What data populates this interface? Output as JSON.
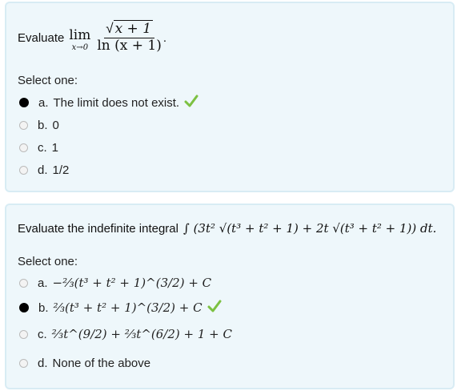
{
  "q1": {
    "prefix": "Evaluate",
    "lim": "lim",
    "lim_sub": "x→0",
    "numerator": "x + 1",
    "denominator": "ln (x + 1)",
    "suffix": ".",
    "select_label": "Select one:",
    "options": [
      {
        "letter": "a.",
        "text": "The limit does not exist.",
        "selected": true,
        "correct_mark": true
      },
      {
        "letter": "b.",
        "text": "0",
        "selected": false
      },
      {
        "letter": "c.",
        "text": "1",
        "selected": false
      },
      {
        "letter": "d.",
        "text": "1/2",
        "selected": false
      }
    ]
  },
  "q2": {
    "prefix": "Evaluate the indefinite integral",
    "integral": "∫ (3t² √(t³ + t² + 1) + 2t √(t³ + t² + 1)) dt.",
    "select_label": "Select one:",
    "options": [
      {
        "letter": "a.",
        "text": "−⅔(t³ + t² + 1)^(3/2) + C",
        "selected": false
      },
      {
        "letter": "b.",
        "text": "⅔(t³ + t² + 1)^(3/2) + C",
        "selected": true,
        "correct_mark": true
      },
      {
        "letter": "c.",
        "text": "⅔t^(9/2) + ⅔t^(6/2) + 1 + C",
        "selected": false
      },
      {
        "letter": "d.",
        "text": "None of the above",
        "selected": false
      }
    ]
  },
  "colors": {
    "check": "#7cc142",
    "card_bg": "#eef7fb",
    "card_border": "#d8ecf4"
  },
  "icons": {
    "correct": "check-icon"
  }
}
